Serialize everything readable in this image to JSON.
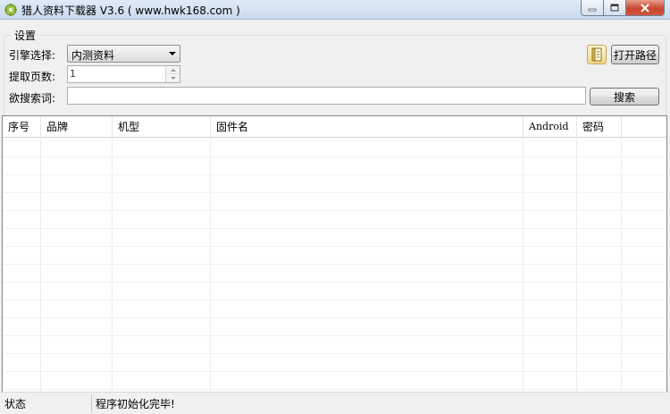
{
  "window": {
    "title": "猎人资料下载器 V3.6 ( www.hwk168.com )"
  },
  "settings": {
    "group_title": "设置",
    "engine_label": "引擎选择:",
    "engine_value": "内测资料",
    "pages_label": "提取页数:",
    "pages_value": "1",
    "keyword_label": "欲搜索词:",
    "keyword_value": "",
    "search_button": "搜索",
    "open_path_button": "打开路径"
  },
  "table": {
    "columns": [
      "序号",
      "品牌",
      "机型",
      "固件名",
      "Android",
      "密码"
    ],
    "rows": []
  },
  "status": {
    "label": "状态",
    "message": "程序初始化完毕!"
  },
  "colors": {
    "title_bar": "#c9daee",
    "panel_bg": "#f0f0f0",
    "close_button": "#c8472e"
  }
}
